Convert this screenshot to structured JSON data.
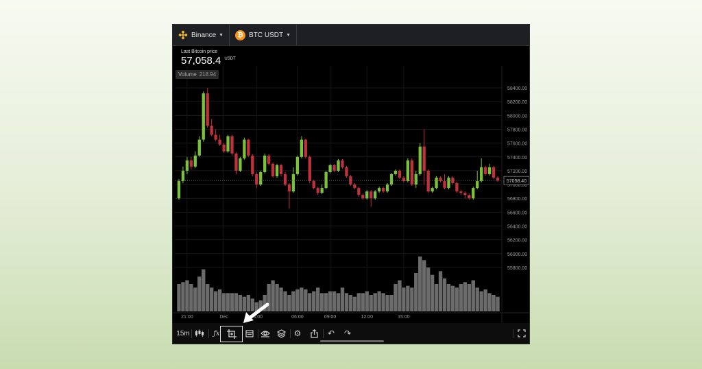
{
  "exchange": {
    "name": "Binance"
  },
  "pair": {
    "name": "BTC USDT"
  },
  "price": {
    "label": "Last Bitcoin price",
    "value": "57,058.4",
    "unit": "USDT"
  },
  "volume": {
    "label": "Volume",
    "value": "218.94"
  },
  "current_price_tag": "57058.40",
  "timeframe": "15m",
  "colors": {
    "up": "#7cc13a",
    "down": "#c0323b",
    "volume": "#6b6b6b",
    "background": "#000000"
  },
  "toolbar_icons": [
    "candles-icon",
    "fx-icon",
    "measure-icon",
    "calendar-icon",
    "eye-icon",
    "layers-icon",
    "gear-icon",
    "share-icon",
    "undo-icon",
    "redo-icon",
    "fullscreen-icon"
  ],
  "chart_data": {
    "type": "candlestick",
    "yticks": [
      "58400.00",
      "58200.00",
      "58000.00",
      "57800.00",
      "57600.00",
      "57400.00",
      "57200.00",
      "57000.00",
      "56800.00",
      "56600.00",
      "56400.00",
      "56200.00",
      "56000.00",
      "55800.00"
    ],
    "ylim": [
      55640,
      58520
    ],
    "xticks": [
      "21:00",
      "Dec",
      "03:00",
      "06:00",
      "09:00",
      "12:00",
      "15:00"
    ],
    "candles": [
      [
        56800,
        57050,
        56780,
        57080
      ],
      [
        57050,
        57200,
        57020,
        57260
      ],
      [
        57200,
        57350,
        57150,
        57400
      ],
      [
        57350,
        57260,
        57220,
        57400
      ],
      [
        57260,
        57420,
        57240,
        57480
      ],
      [
        57420,
        57650,
        57400,
        57700
      ],
      [
        57650,
        58320,
        57620,
        58350
      ],
      [
        58320,
        57850,
        57820,
        58400
      ],
      [
        57850,
        57720,
        57700,
        57950
      ],
      [
        57720,
        57650,
        57630,
        57800
      ],
      [
        57650,
        57580,
        57560,
        57720
      ],
      [
        57580,
        57480,
        57460,
        57600
      ],
      [
        57480,
        57700,
        57460,
        57720
      ],
      [
        57700,
        57450,
        57420,
        57720
      ],
      [
        57450,
        57200,
        57150,
        57470
      ],
      [
        57200,
        57380,
        57180,
        57400
      ],
      [
        57380,
        57650,
        57360,
        57680
      ],
      [
        57650,
        57420,
        57400,
        57660
      ],
      [
        57420,
        57150,
        57120,
        57440
      ],
      [
        57150,
        57000,
        56950,
        57180
      ],
      [
        57000,
        57180,
        56980,
        57200
      ],
      [
        57180,
        57420,
        57160,
        57450
      ],
      [
        57420,
        57300,
        57280,
        57440
      ],
      [
        57300,
        57120,
        57100,
        57320
      ],
      [
        57120,
        57280,
        57100,
        57300
      ],
      [
        57280,
        57150,
        57120,
        57300
      ],
      [
        57150,
        57000,
        56980,
        57180
      ],
      [
        57000,
        56900,
        56650,
        57020
      ],
      [
        56900,
        57150,
        56880,
        57250
      ],
      [
        57150,
        57400,
        57130,
        57420
      ],
      [
        57400,
        57650,
        57380,
        57700
      ],
      [
        57650,
        57400,
        57380,
        57660
      ],
      [
        57400,
        57050,
        57020,
        57420
      ],
      [
        57050,
        56950,
        56930,
        57070
      ],
      [
        56950,
        56880,
        56850,
        56970
      ],
      [
        56880,
        56950,
        56860,
        57000
      ],
      [
        56950,
        57180,
        56930,
        57200
      ],
      [
        57180,
        57280,
        57160,
        57300
      ],
      [
        57280,
        57200,
        57180,
        57300
      ],
      [
        57200,
        57350,
        57180,
        57370
      ],
      [
        57350,
        57250,
        57230,
        57370
      ],
      [
        57250,
        57120,
        57100,
        57270
      ],
      [
        57120,
        57000,
        56980,
        57140
      ],
      [
        57000,
        56950,
        56930,
        57020
      ],
      [
        56950,
        56850,
        56820,
        56970
      ],
      [
        56850,
        56800,
        56780,
        56870
      ],
      [
        56800,
        56900,
        56780,
        56920
      ],
      [
        56900,
        56800,
        56680,
        56920
      ],
      [
        56800,
        56900,
        56780,
        56920
      ],
      [
        56900,
        56950,
        56880,
        56970
      ],
      [
        56950,
        56900,
        56880,
        56970
      ],
      [
        56900,
        57000,
        56880,
        57020
      ],
      [
        57000,
        57150,
        56980,
        57170
      ],
      [
        57150,
        57200,
        57130,
        57220
      ],
      [
        57200,
        57100,
        57080,
        57220
      ],
      [
        57100,
        57050,
        57030,
        57120
      ],
      [
        57050,
        57350,
        57030,
        57380
      ],
      [
        57350,
        57000,
        56980,
        57380
      ],
      [
        57000,
        57150,
        56950,
        57200
      ],
      [
        57150,
        57550,
        57130,
        57600
      ],
      [
        57550,
        57200,
        57000,
        57800
      ],
      [
        57200,
        56900,
        56880,
        57220
      ],
      [
        56900,
        56950,
        56880,
        56970
      ],
      [
        56950,
        57100,
        56930,
        57120
      ],
      [
        57100,
        57050,
        57030,
        57120
      ],
      [
        57050,
        56950,
        56930,
        57150
      ],
      [
        56950,
        57100,
        56930,
        57120
      ],
      [
        57100,
        57020,
        57000,
        57120
      ],
      [
        57020,
        56900,
        56880,
        57040
      ],
      [
        56900,
        56880,
        56850,
        56920
      ],
      [
        56880,
        56850,
        56800,
        56900
      ],
      [
        56850,
        56800,
        56780,
        56870
      ],
      [
        56800,
        56950,
        56780,
        56970
      ],
      [
        56950,
        57050,
        56930,
        57200
      ],
      [
        57050,
        57250,
        57030,
        57380
      ],
      [
        57250,
        57150,
        57130,
        57270
      ],
      [
        57150,
        57250,
        57130,
        57300
      ],
      [
        57250,
        57100,
        57080,
        57270
      ],
      [
        57100,
        57058,
        57040,
        57120
      ]
    ],
    "volume_pct": [
      0.3,
      0.32,
      0.34,
      0.3,
      0.26,
      0.38,
      0.46,
      0.3,
      0.26,
      0.22,
      0.24,
      0.2,
      0.2,
      0.2,
      0.2,
      0.18,
      0.16,
      0.18,
      0.14,
      0.1,
      0.12,
      0.18,
      0.3,
      0.34,
      0.3,
      0.26,
      0.22,
      0.18,
      0.22,
      0.24,
      0.26,
      0.24,
      0.2,
      0.22,
      0.26,
      0.2,
      0.2,
      0.22,
      0.22,
      0.2,
      0.26,
      0.2,
      0.18,
      0.16,
      0.2,
      0.2,
      0.22,
      0.18,
      0.2,
      0.22,
      0.2,
      0.18,
      0.18,
      0.3,
      0.34,
      0.26,
      0.28,
      0.26,
      0.42,
      0.6,
      0.56,
      0.48,
      0.4,
      0.3,
      0.44,
      0.36,
      0.3,
      0.28,
      0.26,
      0.3,
      0.32,
      0.3,
      0.34,
      0.26,
      0.22,
      0.24,
      0.2,
      0.18,
      0.16,
      0.14
    ]
  }
}
